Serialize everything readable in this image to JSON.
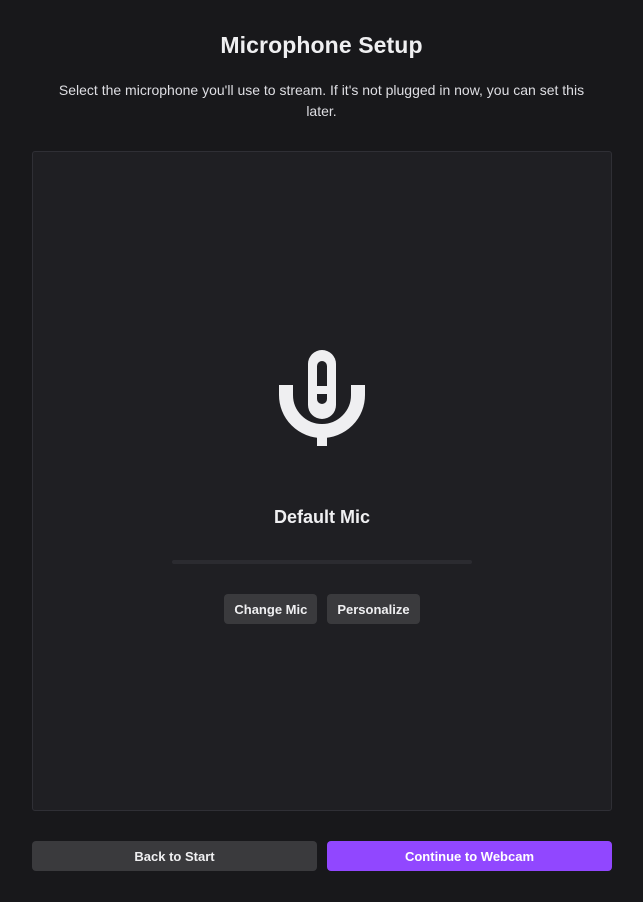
{
  "header": {
    "title": "Microphone Setup",
    "subtitle": "Select the microphone you'll use to stream. If it's not plugged in now, you can set this later."
  },
  "panel": {
    "icon": "microphone-icon",
    "mic_name": "Default Mic",
    "input_level": 0,
    "buttons": {
      "change_mic": "Change Mic",
      "personalize": "Personalize"
    }
  },
  "footer": {
    "back_label": "Back to Start",
    "continue_label": "Continue to Webcam"
  },
  "colors": {
    "background": "#18181b",
    "panel": "#1f1f23",
    "secondary_button": "#3a3a3d",
    "accent": "#9147ff",
    "text": "#efeff1"
  }
}
